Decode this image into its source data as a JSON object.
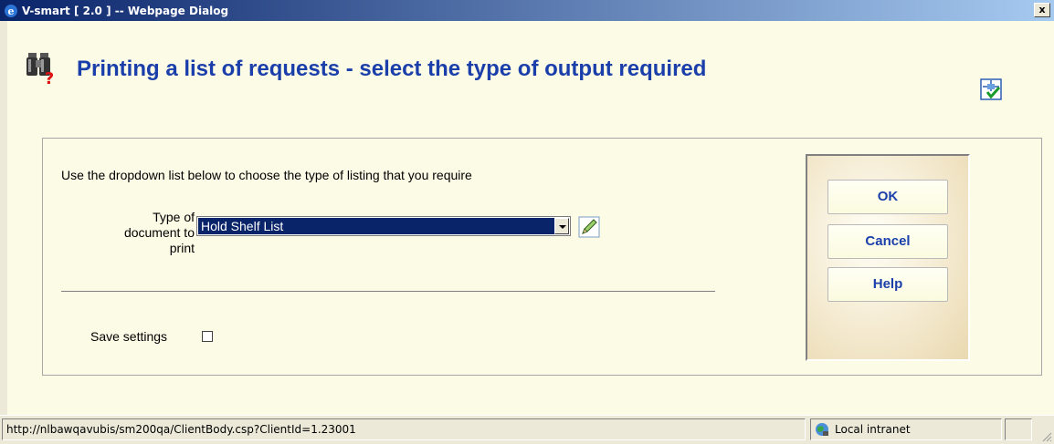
{
  "window": {
    "title": "V-smart [ 2.0 ] -- Webpage Dialog",
    "close_label": "x"
  },
  "page": {
    "title": "Printing a list of requests - select the type of output required"
  },
  "form": {
    "instruction": "Use the dropdown list below to choose the type of listing that you require",
    "type_label": "Type of document to print",
    "type_value": "Hold Shelf List",
    "save_label": "Save settings",
    "save_checked": false
  },
  "buttons": {
    "ok": "OK",
    "cancel": "Cancel",
    "help": "Help"
  },
  "statusbar": {
    "url": "http://nlbawqavubis/sm200qa/ClientBody.csp?ClientId=1.23001",
    "zone": "Local intranet"
  },
  "colors": {
    "title_blue": "#1b3faa",
    "selection": "#0a246a",
    "background": "#fcfbe6"
  },
  "icons": [
    "ie-icon",
    "binoculars-question-icon",
    "select-check-icon",
    "pencil-icon",
    "globe-icon",
    "resize-grip-icon"
  ]
}
